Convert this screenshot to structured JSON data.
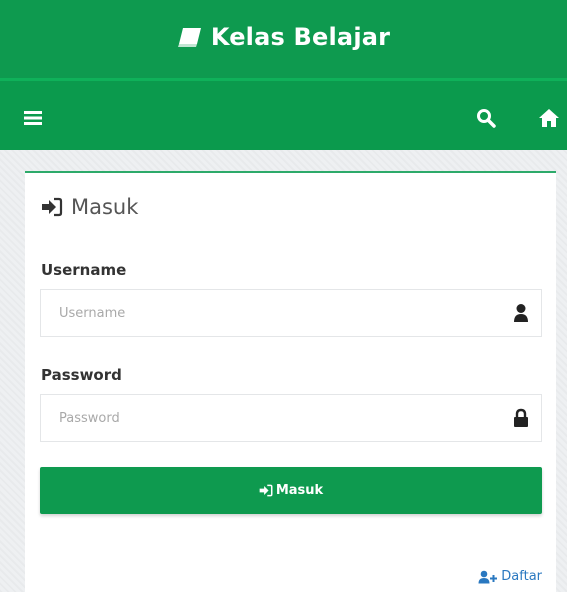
{
  "header": {
    "brand_icon": "book-icon",
    "brand_title": "Kelas Belajar",
    "brand_color": "#0e9a4f"
  },
  "navbar": {
    "menu_icon": "menu-icon",
    "search_icon": "search-icon",
    "home_icon": "home-icon"
  },
  "login": {
    "heading_icon": "sign-in-icon",
    "heading": "Masuk",
    "username_label": "Username",
    "username_placeholder": "Username",
    "username_value": "",
    "username_icon": "user-icon",
    "password_label": "Password",
    "password_placeholder": "Password",
    "password_value": "",
    "password_icon": "lock-icon",
    "submit_label": "Masuk",
    "register_icon": "user-plus-icon",
    "register_label": "Daftar",
    "link_color": "#2a78c0"
  }
}
